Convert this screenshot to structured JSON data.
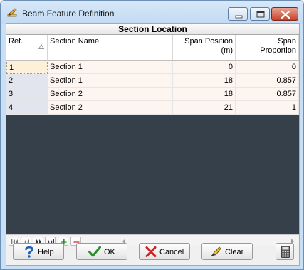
{
  "window": {
    "title": "Beam Feature Definition",
    "icons": {
      "app": "pencil-ruler-icon",
      "minimize": "minimize-icon",
      "maximize": "maximize-icon",
      "close": "close-icon"
    }
  },
  "grid": {
    "title": "Section Location",
    "columns": {
      "ref": "Ref.",
      "name": "Section Name",
      "span_position_line1": "Span Position",
      "span_position_line2": "(m)",
      "span_proportion_line1": "Span",
      "span_proportion_line2": "Proportion"
    },
    "rows": [
      {
        "ref": "1",
        "name": "Section 1",
        "position": "0",
        "proportion": "0"
      },
      {
        "ref": "2",
        "name": "Section 1",
        "position": "18",
        "proportion": "0.857"
      },
      {
        "ref": "3",
        "name": "Section 2",
        "position": "18",
        "proportion": "0.857"
      },
      {
        "ref": "4",
        "name": "Section 2",
        "position": "21",
        "proportion": "1"
      }
    ],
    "sort_icon": "sort-ascending-icon"
  },
  "navigator": {
    "icons": [
      "first-record-icon",
      "prev-page-icon",
      "next-page-icon",
      "last-record-icon",
      "add-record-icon",
      "delete-record-icon"
    ]
  },
  "buttons": {
    "help": "Help",
    "ok": "OK",
    "cancel": "Cancel",
    "clear": "Clear",
    "calculator_icon": "calculator-icon"
  },
  "colors": {
    "grid_background": "#36404b",
    "row_background": "#fdf5f0",
    "ok_check": "#2a8f2a",
    "cancel_x": "#cc2222",
    "add": "#2a8f2a",
    "delete": "#cc2222"
  }
}
